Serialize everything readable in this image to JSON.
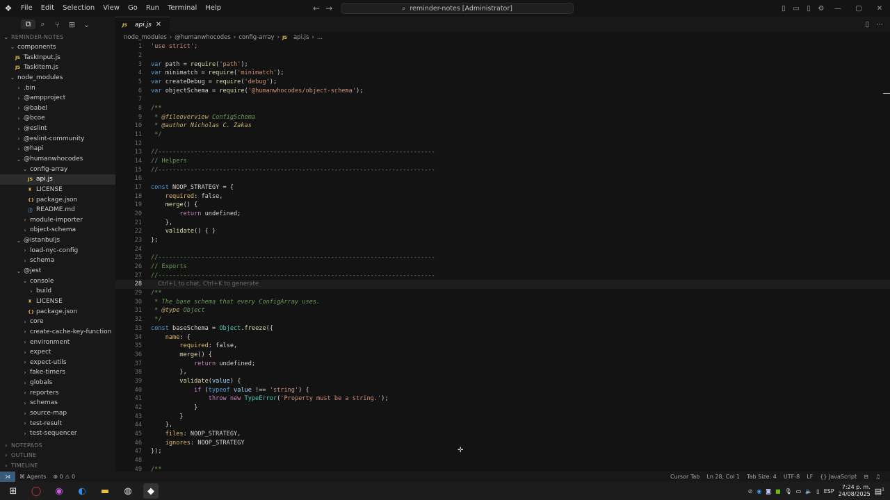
{
  "titlebar": {
    "menu": [
      "File",
      "Edit",
      "Selection",
      "View",
      "Go",
      "Run",
      "Terminal",
      "Help"
    ],
    "command_center": "reminder-notes [Administrator]"
  },
  "tabs": [
    {
      "label": "api.js"
    }
  ],
  "breadcrumbs": [
    "node_modules",
    "@humanwhocodes",
    "config-array",
    "api.js",
    "..."
  ],
  "explorer": {
    "root": "REMINDER-NOTES",
    "sections_bottom": [
      "NOTEPADS",
      "OUTLINE",
      "TIMELINE"
    ],
    "tree": [
      {
        "label": "components",
        "indent": 1,
        "type": "folder-open"
      },
      {
        "label": "TaskInput.js",
        "indent": 2,
        "type": "js"
      },
      {
        "label": "TaskItem.js",
        "indent": 2,
        "type": "js"
      },
      {
        "label": "node_modules",
        "indent": 1,
        "type": "folder-open"
      },
      {
        "label": ".bin",
        "indent": 2,
        "type": "folder"
      },
      {
        "label": "@ampproject",
        "indent": 2,
        "type": "folder"
      },
      {
        "label": "@babel",
        "indent": 2,
        "type": "folder"
      },
      {
        "label": "@bcoe",
        "indent": 2,
        "type": "folder"
      },
      {
        "label": "@eslint",
        "indent": 2,
        "type": "folder"
      },
      {
        "label": "@eslint-community",
        "indent": 2,
        "type": "folder"
      },
      {
        "label": "@hapi",
        "indent": 2,
        "type": "folder"
      },
      {
        "label": "@humanwhocodes",
        "indent": 2,
        "type": "folder-open"
      },
      {
        "label": "config-array",
        "indent": 3,
        "type": "folder-open"
      },
      {
        "label": "api.js",
        "indent": 4,
        "type": "js",
        "selected": true
      },
      {
        "label": "LICENSE",
        "indent": 4,
        "type": "lic"
      },
      {
        "label": "package.json",
        "indent": 4,
        "type": "json"
      },
      {
        "label": "README.md",
        "indent": 4,
        "type": "md"
      },
      {
        "label": "module-importer",
        "indent": 3,
        "type": "folder"
      },
      {
        "label": "object-schema",
        "indent": 3,
        "type": "folder"
      },
      {
        "label": "@istanbuljs",
        "indent": 2,
        "type": "folder-open"
      },
      {
        "label": "load-nyc-config",
        "indent": 3,
        "type": "folder"
      },
      {
        "label": "schema",
        "indent": 3,
        "type": "folder"
      },
      {
        "label": "@jest",
        "indent": 2,
        "type": "folder-open"
      },
      {
        "label": "console",
        "indent": 3,
        "type": "folder-open"
      },
      {
        "label": "build",
        "indent": 4,
        "type": "folder"
      },
      {
        "label": "LICENSE",
        "indent": 4,
        "type": "lic"
      },
      {
        "label": "package.json",
        "indent": 4,
        "type": "json"
      },
      {
        "label": "core",
        "indent": 3,
        "type": "folder"
      },
      {
        "label": "create-cache-key-function",
        "indent": 3,
        "type": "folder"
      },
      {
        "label": "environment",
        "indent": 3,
        "type": "folder"
      },
      {
        "label": "expect",
        "indent": 3,
        "type": "folder"
      },
      {
        "label": "expect-utils",
        "indent": 3,
        "type": "folder"
      },
      {
        "label": "fake-timers",
        "indent": 3,
        "type": "folder"
      },
      {
        "label": "globals",
        "indent": 3,
        "type": "folder"
      },
      {
        "label": "reporters",
        "indent": 3,
        "type": "folder"
      },
      {
        "label": "schemas",
        "indent": 3,
        "type": "folder"
      },
      {
        "label": "source-map",
        "indent": 3,
        "type": "folder"
      },
      {
        "label": "test-result",
        "indent": 3,
        "type": "folder"
      },
      {
        "label": "test-sequencer",
        "indent": 3,
        "type": "folder"
      }
    ]
  },
  "editor": {
    "current_line": 28,
    "inline_hint": "Ctrl+L to chat, Ctrl+K to generate",
    "lines": [
      {
        "n": 1,
        "segs": [
          [
            "'use strict';",
            "#ce9178"
          ]
        ]
      },
      {
        "n": 2,
        "segs": []
      },
      {
        "n": 3,
        "segs": [
          [
            "var ",
            "#569cd6"
          ],
          [
            "path = ",
            "#d4d4d4"
          ],
          [
            "require",
            "#dcdcaa"
          ],
          [
            "(",
            "#d4d4d4"
          ],
          [
            "'path'",
            "#ce9178"
          ],
          [
            ");",
            "#d4d4d4"
          ]
        ]
      },
      {
        "n": 4,
        "segs": [
          [
            "var ",
            "#569cd6"
          ],
          [
            "minimatch = ",
            "#d4d4d4"
          ],
          [
            "require",
            "#dcdcaa"
          ],
          [
            "(",
            "#d4d4d4"
          ],
          [
            "'minimatch'",
            "#ce9178"
          ],
          [
            ");",
            "#d4d4d4"
          ]
        ]
      },
      {
        "n": 5,
        "segs": [
          [
            "var ",
            "#569cd6"
          ],
          [
            "createDebug = ",
            "#d4d4d4"
          ],
          [
            "require",
            "#dcdcaa"
          ],
          [
            "(",
            "#d4d4d4"
          ],
          [
            "'debug'",
            "#ce9178"
          ],
          [
            ");",
            "#d4d4d4"
          ]
        ]
      },
      {
        "n": 6,
        "segs": [
          [
            "var ",
            "#569cd6"
          ],
          [
            "objectSchema = ",
            "#d4d4d4"
          ],
          [
            "require",
            "#dcdcaa"
          ],
          [
            "(",
            "#d4d4d4"
          ],
          [
            "'@humanwhocodes/object-schema'",
            "#ce9178"
          ],
          [
            ");",
            "#d4d4d4"
          ]
        ]
      },
      {
        "n": 7,
        "segs": []
      },
      {
        "n": 8,
        "segs": [
          [
            "/**",
            "#6a9955"
          ]
        ]
      },
      {
        "n": 9,
        "segs": [
          [
            " * ",
            "#6a9955"
          ],
          [
            "@fileoverview",
            "#c8b06a"
          ],
          [
            " ConfigSchema",
            "#6a9955"
          ]
        ]
      },
      {
        "n": 10,
        "segs": [
          [
            " * ",
            "#6a9955"
          ],
          [
            "@author",
            "#c8b06a"
          ],
          [
            " Nicholas C. Zakas",
            "#c8b06a"
          ]
        ]
      },
      {
        "n": 11,
        "segs": [
          [
            " */",
            "#6a9955"
          ]
        ]
      },
      {
        "n": 12,
        "segs": []
      },
      {
        "n": 13,
        "segs": [
          [
            "//-----------------------------------------------------------------------------",
            "#6a9955"
          ]
        ]
      },
      {
        "n": 14,
        "segs": [
          [
            "// Helpers",
            "#6a9955"
          ]
        ]
      },
      {
        "n": 15,
        "segs": [
          [
            "//-----------------------------------------------------------------------------",
            "#6a9955"
          ]
        ]
      },
      {
        "n": 16,
        "segs": []
      },
      {
        "n": 17,
        "segs": [
          [
            "const ",
            "#569cd6"
          ],
          [
            "NOOP_STRATEGY = {",
            "#d4d4d4"
          ]
        ]
      },
      {
        "n": 18,
        "segs": [
          [
            "    required",
            "#e0b96a"
          ],
          [
            ": false,",
            "#d4d4d4"
          ]
        ]
      },
      {
        "n": 19,
        "segs": [
          [
            "    merge",
            "#dcdcaa"
          ],
          [
            "() {",
            "#d4d4d4"
          ]
        ]
      },
      {
        "n": 20,
        "segs": [
          [
            "        return ",
            "#c586c0"
          ],
          [
            "undefined;",
            "#d4d4d4"
          ]
        ]
      },
      {
        "n": 21,
        "segs": [
          [
            "    },",
            "#d4d4d4"
          ]
        ]
      },
      {
        "n": 22,
        "segs": [
          [
            "    validate",
            "#dcdcaa"
          ],
          [
            "() { }",
            "#d4d4d4"
          ]
        ]
      },
      {
        "n": 23,
        "segs": [
          [
            "};",
            "#d4d4d4"
          ]
        ]
      },
      {
        "n": 24,
        "segs": []
      },
      {
        "n": 25,
        "segs": [
          [
            "//-----------------------------------------------------------------------------",
            "#6a9955"
          ]
        ]
      },
      {
        "n": 26,
        "segs": [
          [
            "// Exports",
            "#6a9955"
          ]
        ]
      },
      {
        "n": 27,
        "segs": [
          [
            "//-----------------------------------------------------------------------------",
            "#6a9955"
          ]
        ]
      },
      {
        "n": 28,
        "segs": [],
        "hint": true
      },
      {
        "n": 29,
        "segs": [
          [
            "/**",
            "#6a9955"
          ]
        ]
      },
      {
        "n": 30,
        "segs": [
          [
            " * The base schema that every ConfigArray uses.",
            "#6a9955"
          ]
        ]
      },
      {
        "n": 31,
        "segs": [
          [
            " * ",
            "#6a9955"
          ],
          [
            "@type",
            "#c8b06a"
          ],
          [
            " Object",
            "#6a9955"
          ]
        ]
      },
      {
        "n": 32,
        "segs": [
          [
            " */",
            "#6a9955"
          ]
        ]
      },
      {
        "n": 33,
        "segs": [
          [
            "const ",
            "#569cd6"
          ],
          [
            "baseSchema = ",
            "#d4d4d4"
          ],
          [
            "Object",
            "#4ec9b0"
          ],
          [
            ".",
            "#d4d4d4"
          ],
          [
            "freeze",
            "#dcdcaa"
          ],
          [
            "({",
            "#d4d4d4"
          ]
        ]
      },
      {
        "n": 34,
        "segs": [
          [
            "    name",
            "#e0b96a"
          ],
          [
            ": {",
            "#d4d4d4"
          ]
        ]
      },
      {
        "n": 35,
        "segs": [
          [
            "        required",
            "#e0b96a"
          ],
          [
            ": false,",
            "#d4d4d4"
          ]
        ]
      },
      {
        "n": 36,
        "segs": [
          [
            "        merge",
            "#dcdcaa"
          ],
          [
            "() {",
            "#d4d4d4"
          ]
        ]
      },
      {
        "n": 37,
        "segs": [
          [
            "            return ",
            "#c586c0"
          ],
          [
            "undefined;",
            "#d4d4d4"
          ]
        ]
      },
      {
        "n": 38,
        "segs": [
          [
            "        },",
            "#d4d4d4"
          ]
        ]
      },
      {
        "n": 39,
        "segs": [
          [
            "        validate",
            "#dcdcaa"
          ],
          [
            "(",
            "#d4d4d4"
          ],
          [
            "value",
            "#9cdcfe"
          ],
          [
            ") {",
            "#d4d4d4"
          ]
        ]
      },
      {
        "n": 40,
        "segs": [
          [
            "            if ",
            "#c586c0"
          ],
          [
            "(",
            "#d4d4d4"
          ],
          [
            "typeof ",
            "#569cd6"
          ],
          [
            "value",
            "#9cdcfe"
          ],
          [
            " !== ",
            "#d4d4d4"
          ],
          [
            "'string'",
            "#ce9178"
          ],
          [
            ") {",
            "#d4d4d4"
          ]
        ]
      },
      {
        "n": 41,
        "segs": [
          [
            "                throw new ",
            "#c586c0"
          ],
          [
            "TypeError",
            "#4ec9b0"
          ],
          [
            "(",
            "#d4d4d4"
          ],
          [
            "'Property must be a string.'",
            "#ce9178"
          ],
          [
            ");",
            "#d4d4d4"
          ]
        ]
      },
      {
        "n": 42,
        "segs": [
          [
            "            }",
            "#d4d4d4"
          ]
        ]
      },
      {
        "n": 43,
        "segs": [
          [
            "        }",
            "#d4d4d4"
          ]
        ]
      },
      {
        "n": 44,
        "segs": [
          [
            "    },",
            "#d4d4d4"
          ]
        ]
      },
      {
        "n": 45,
        "segs": [
          [
            "    files",
            "#e0b96a"
          ],
          [
            ": NOOP_STRATEGY,",
            "#d4d4d4"
          ]
        ]
      },
      {
        "n": 46,
        "segs": [
          [
            "    ignores",
            "#e0b96a"
          ],
          [
            ": NOOP_STRATEGY",
            "#d4d4d4"
          ]
        ]
      },
      {
        "n": 47,
        "segs": [
          [
            "});",
            "#d4d4d4"
          ]
        ]
      },
      {
        "n": 48,
        "segs": []
      },
      {
        "n": 49,
        "segs": [
          [
            "/**",
            "#6a9955"
          ]
        ]
      }
    ]
  },
  "statusbar": {
    "agents": "Agents",
    "problems": "⊗ 0 ⚠ 0",
    "cursor_tab": "Cursor Tab",
    "position": "Ln 28, Col 1",
    "tab_size": "Tab Size: 4",
    "encoding": "UTF-8",
    "eol": "LF",
    "language": "JavaScript"
  },
  "taskbar": {
    "lang": "ESP",
    "time": "7:24 p. m.",
    "date": "24/08/2025",
    "notif": "1"
  }
}
